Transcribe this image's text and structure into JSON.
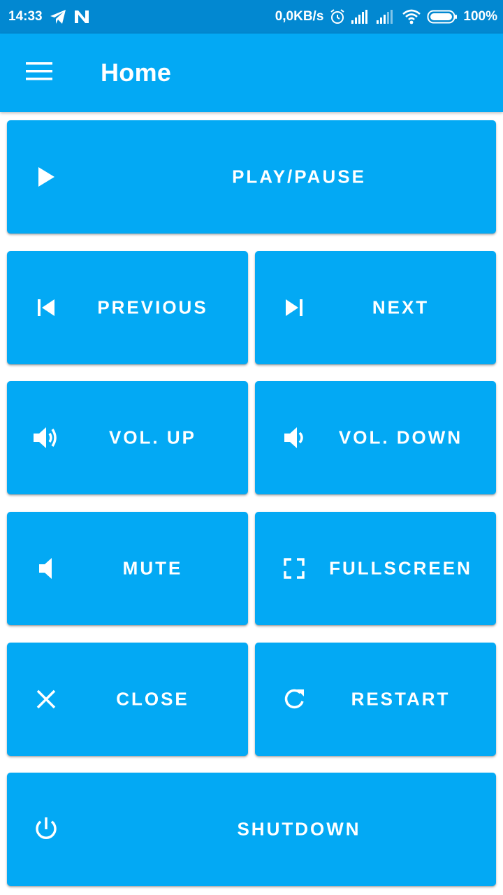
{
  "status_bar": {
    "time": "14:33",
    "network_speed": "0,0KB/s",
    "battery": "100%",
    "icons": [
      "telegram-icon",
      "n-notification-icon",
      "alarm-icon",
      "signal-icon",
      "signal-icon",
      "wifi-icon",
      "battery-icon"
    ]
  },
  "app_bar": {
    "title": "Home",
    "menu_icon": "hamburger-menu-icon"
  },
  "buttons": {
    "play_pause": {
      "label": "PLAY/PAUSE",
      "icon": "play-icon"
    },
    "previous": {
      "label": "PREVIOUS",
      "icon": "skip-previous-icon"
    },
    "next": {
      "label": "NEXT",
      "icon": "skip-next-icon"
    },
    "vol_up": {
      "label": "VOL. UP",
      "icon": "volume-up-icon"
    },
    "vol_down": {
      "label": "VOL. DOWN",
      "icon": "volume-down-icon"
    },
    "mute": {
      "label": "MUTE",
      "icon": "volume-mute-icon"
    },
    "fullscreen": {
      "label": "FULLSCREEN",
      "icon": "fullscreen-icon"
    },
    "close": {
      "label": "CLOSE",
      "icon": "close-icon"
    },
    "restart": {
      "label": "RESTART",
      "icon": "refresh-icon"
    },
    "shutdown": {
      "label": "SHUTDOWN",
      "icon": "power-icon"
    }
  },
  "colors": {
    "status_bar": "#0288D1",
    "primary": "#03A9F4",
    "text": "#FFFFFF"
  }
}
